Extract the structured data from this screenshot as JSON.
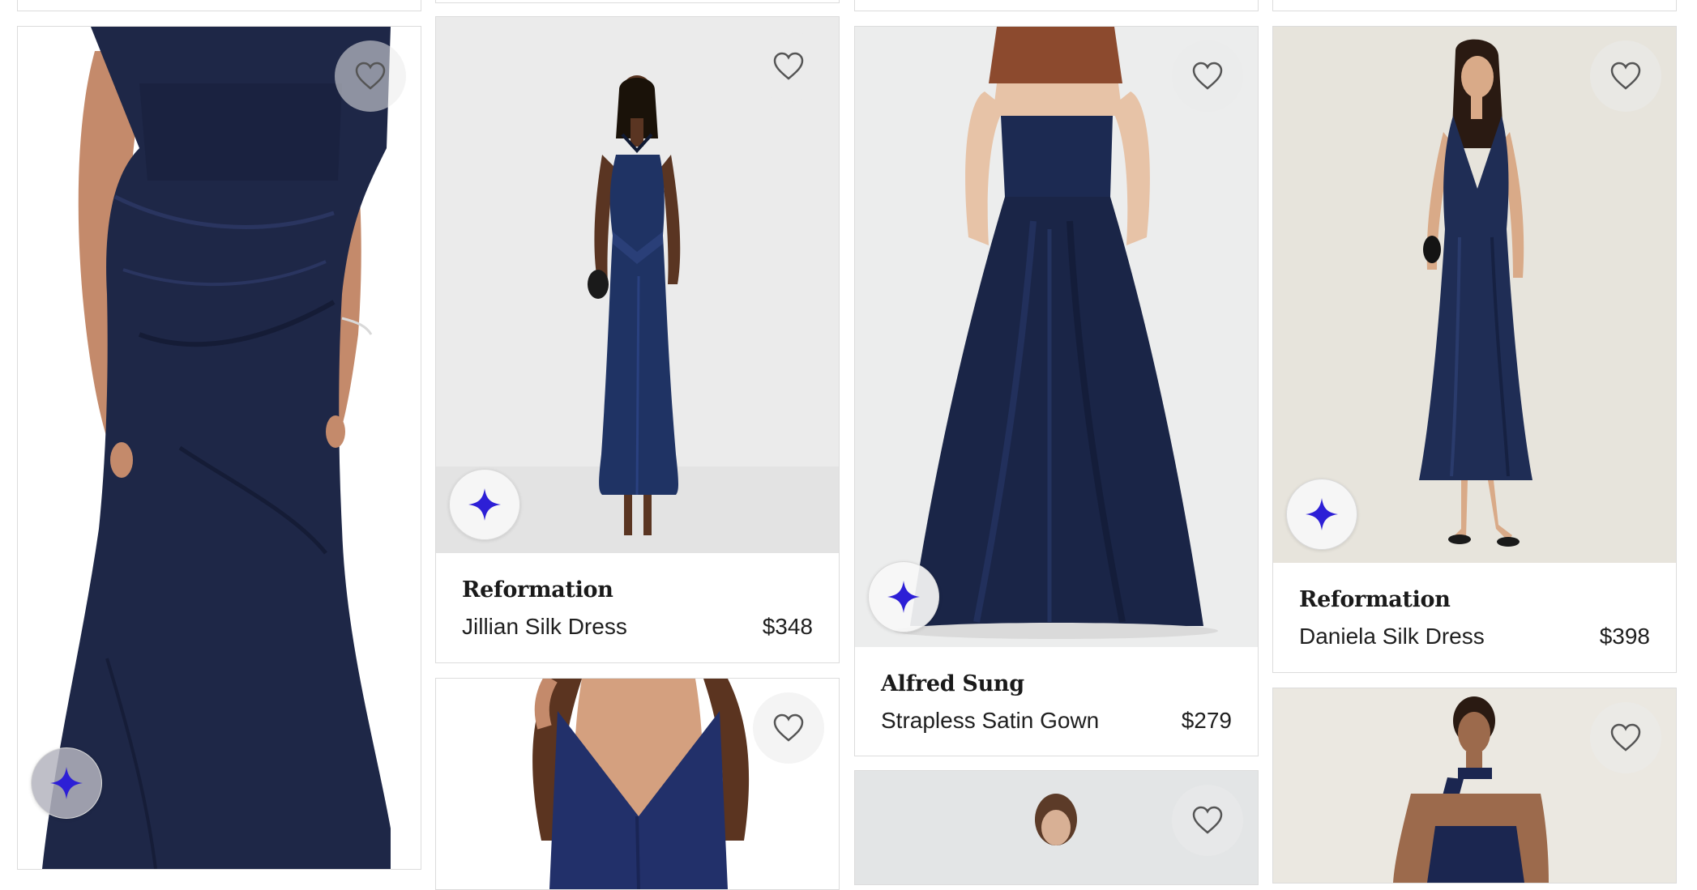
{
  "icons": {
    "favorite": "heart-outline-icon",
    "ai_assist": "sparkle-icon"
  },
  "colors": {
    "sparkle": "#2d1fd6",
    "navy_dress": "#1b2547",
    "border": "#dcdcdc"
  },
  "products": [
    {
      "brand": "Reformation",
      "name": "Jillian Silk Dress",
      "price": "$348"
    },
    {
      "brand": "Alfred Sung",
      "name": "Strapless Satin Gown",
      "price": "$279"
    },
    {
      "brand": "Reformation",
      "name": "Daniela Silk Dress",
      "price": "$398"
    }
  ]
}
